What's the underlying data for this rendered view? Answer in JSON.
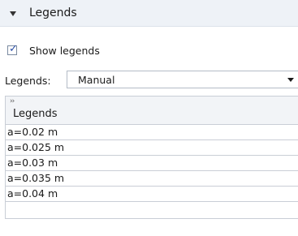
{
  "section": {
    "title": "Legends"
  },
  "show_legends": {
    "label": "Show legends",
    "checked": true
  },
  "legends_select": {
    "label": "Legends:",
    "value": "Manual"
  },
  "table": {
    "header": "Legends",
    "rows": [
      "a=0.02 m",
      "a=0.025 m",
      "a=0.03 m",
      "a=0.035 m",
      "a=0.04 m",
      ""
    ]
  },
  "colors": {
    "header_bg": "#eef2f7",
    "check": "#2b4fa8"
  }
}
